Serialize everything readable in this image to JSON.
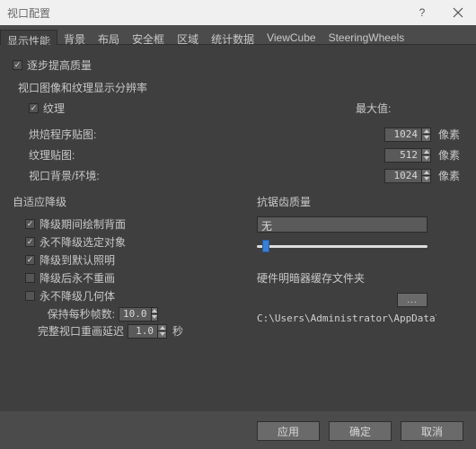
{
  "window": {
    "title": "视口配置"
  },
  "tabs": [
    "显示性能",
    "背景",
    "布局",
    "安全框",
    "区域",
    "统计数据",
    "ViewCube",
    "SteeringWheels"
  ],
  "progressive": {
    "checkbox_label": "逐步提高质量",
    "section_label": "视口图像和纹理显示分辨率",
    "texture_label": "纹理",
    "max_label": "最大值:",
    "rows": [
      {
        "label": "烘焙程序贴图:",
        "value": "1024",
        "unit": "像素"
      },
      {
        "label": "纹理贴图:",
        "value": "512",
        "unit": "像素"
      },
      {
        "label": "视口背景/环境:",
        "value": "1024",
        "unit": "像素"
      }
    ]
  },
  "adaptive": {
    "section_label": "自适应降级",
    "items": [
      {
        "label": "降级期间绘制背面",
        "checked": true
      },
      {
        "label": "永不降级选定对象",
        "checked": true
      },
      {
        "label": "降级到默认照明",
        "checked": true
      },
      {
        "label": "降级后永不重画",
        "checked": false
      },
      {
        "label": "永不降级几何体",
        "checked": false
      }
    ],
    "fps_label": "保持每秒帧数:",
    "fps_value": "10.0",
    "delay_label": "完整视口重画延迟",
    "delay_value": "1.0",
    "delay_unit": "秒"
  },
  "antialias": {
    "section_label": "抗锯齿质量",
    "selected": "无"
  },
  "cache": {
    "section_label": "硬件明暗器缓存文件夹",
    "browse_label": "...",
    "path": "C:\\Users\\Administrator\\AppData\\Local\\A"
  },
  "buttons": {
    "apply": "应用",
    "ok": "确定",
    "cancel": "取消"
  }
}
